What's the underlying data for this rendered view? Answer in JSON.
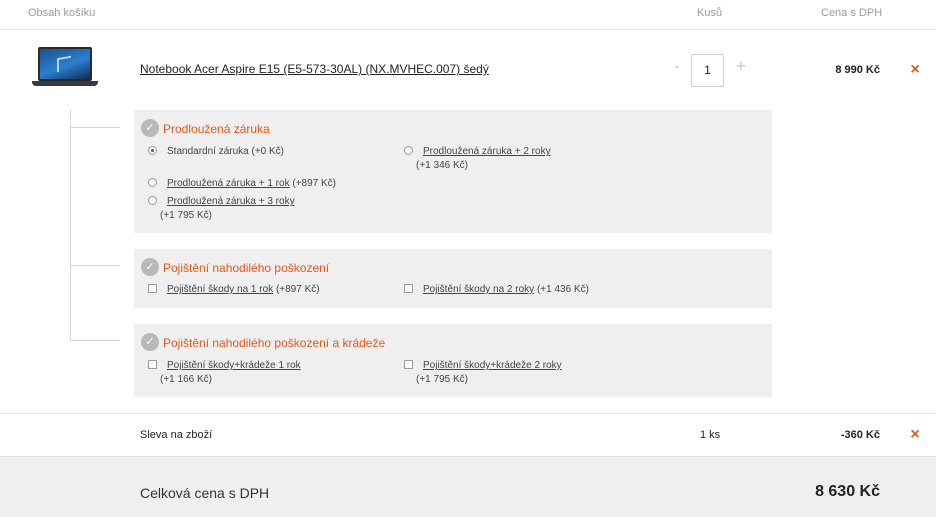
{
  "header": {
    "cart_contents": "Obsah košíku",
    "quantity": "Kusů",
    "price_vat": "Cena s DPH"
  },
  "product": {
    "name": "Notebook Acer Aspire E15 (E5-573-30AL) (NX.MVHEC.007) šedý",
    "quantity": "1",
    "minus": "-",
    "plus": "+",
    "price": "8 990 Kč",
    "remove": "×"
  },
  "services": [
    {
      "title": "Prodloužená záruka",
      "control": "radio",
      "options": [
        {
          "label": "Standardní záruka",
          "extra": "(+0 Kč)",
          "sub": "",
          "selected": true
        },
        {
          "label": "Prodloužená záruka + 2 roky",
          "extra": "",
          "sub": "(+1 346 Kč)",
          "selected": false
        },
        {
          "label": "Prodloužená záruka + 1 rok",
          "extra": "(+897 Kč)",
          "sub": "",
          "selected": false
        },
        {
          "label": "Prodloužená záruka + 3 roky",
          "extra": "",
          "sub": "(+1 795 Kč)",
          "selected": false
        }
      ]
    },
    {
      "title": "Pojištění nahodilého poškození",
      "control": "checkbox",
      "options": [
        {
          "label": "Pojištění škody na 1 rok",
          "extra": "(+897 Kč)",
          "sub": "",
          "selected": false
        },
        {
          "label": "Pojištění škody na 2 roky",
          "extra": "(+1 436 Kč)",
          "sub": "",
          "selected": false
        }
      ]
    },
    {
      "title": "Pojištění nahodilého poškození a krádeže",
      "control": "checkbox",
      "options": [
        {
          "label": "Pojištění škody+krádeže 1 rok",
          "extra": "",
          "sub": "(+1 166 Kč)",
          "selected": false
        },
        {
          "label": "Pojištění škody+krádeže 2 roky",
          "extra": "",
          "sub": "(+1 795 Kč)",
          "selected": false
        }
      ]
    }
  ],
  "discount": {
    "label": "Sleva na zboží",
    "quantity": "1 ks",
    "price": "-360 Kč",
    "remove": "×"
  },
  "total": {
    "label": "Celková cena s DPH",
    "price": "8 630 Kč"
  },
  "icons": {
    "service_badge": "check-badge-icon",
    "remove": "close-icon"
  },
  "colors": {
    "accent": "#e05a1c",
    "panel": "#efefef"
  }
}
